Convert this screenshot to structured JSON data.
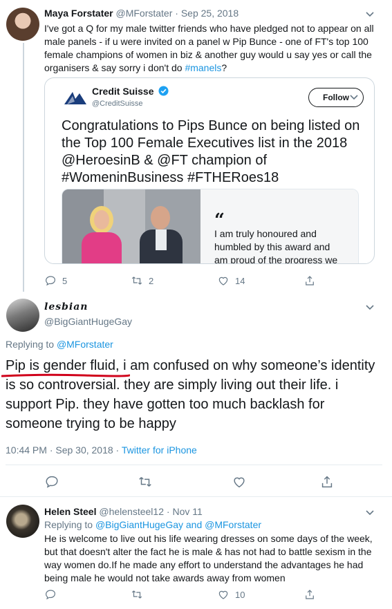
{
  "tweet1": {
    "name": "Maya Forstater",
    "handle": "@MForstater",
    "dot": "·",
    "date": "Sep 25, 2018",
    "text_before": "I've got a Q for my male twitter friends who have pledged not to appear on all male panels - if u were invited on a panel w Pip Bunce - one of FT's top 100 female champions of women in biz & another guy would u say yes or call the organisers & say sorry i don't do ",
    "hashtag": "#manels",
    "text_after": "?",
    "replies": "5",
    "retweets": "2",
    "likes": "14"
  },
  "quoted": {
    "name": "Credit Suisse",
    "handle": "@CreditSuisse",
    "follow_label": "Follow",
    "text": "Congratulations to Pips Bunce on being listed on the Top 100 Female Executives list in the 2018 @HeroesinB & @FT champion of #WomeninBusiness #FTHERoes18",
    "quote_mark": "“",
    "quote_body": "I am truly honoured and humbled by this award and am proud of the progress we are making"
  },
  "tweet2": {
    "name": "lesbian",
    "handle": "@BigGiantHugeGay",
    "replying_label": "Replying to",
    "replying_to": "@MForstater",
    "text": "Pip is gender fluid, i am confused on why someone’s identity is so controversial. they are simply living out their life. i support Pip. they have gotten too much backlash for someone trying to be happy",
    "time": "10:44 PM · Sep 30, 2018 ·",
    "source": "Twitter for iPhone"
  },
  "tweet3": {
    "name": "Helen Steel",
    "handle": "@helensteel12",
    "dot": "·",
    "date": "Nov 11",
    "replying_label": "Replying to",
    "replying_to": "@BigGiantHugeGay and @MForstater",
    "text": "He is welcome to live out his life wearing dresses on some days of the week, but that doesn't alter the fact he is male & has not had to battle sexism in the way women do.If he made any effort to understand the advantages he had being male he would not take awards away from women",
    "replies": "",
    "retweets": "",
    "likes": "10"
  },
  "colors": {
    "accent": "#1b95e0",
    "underline": "#d0021b",
    "verified": "#1da1f2"
  }
}
